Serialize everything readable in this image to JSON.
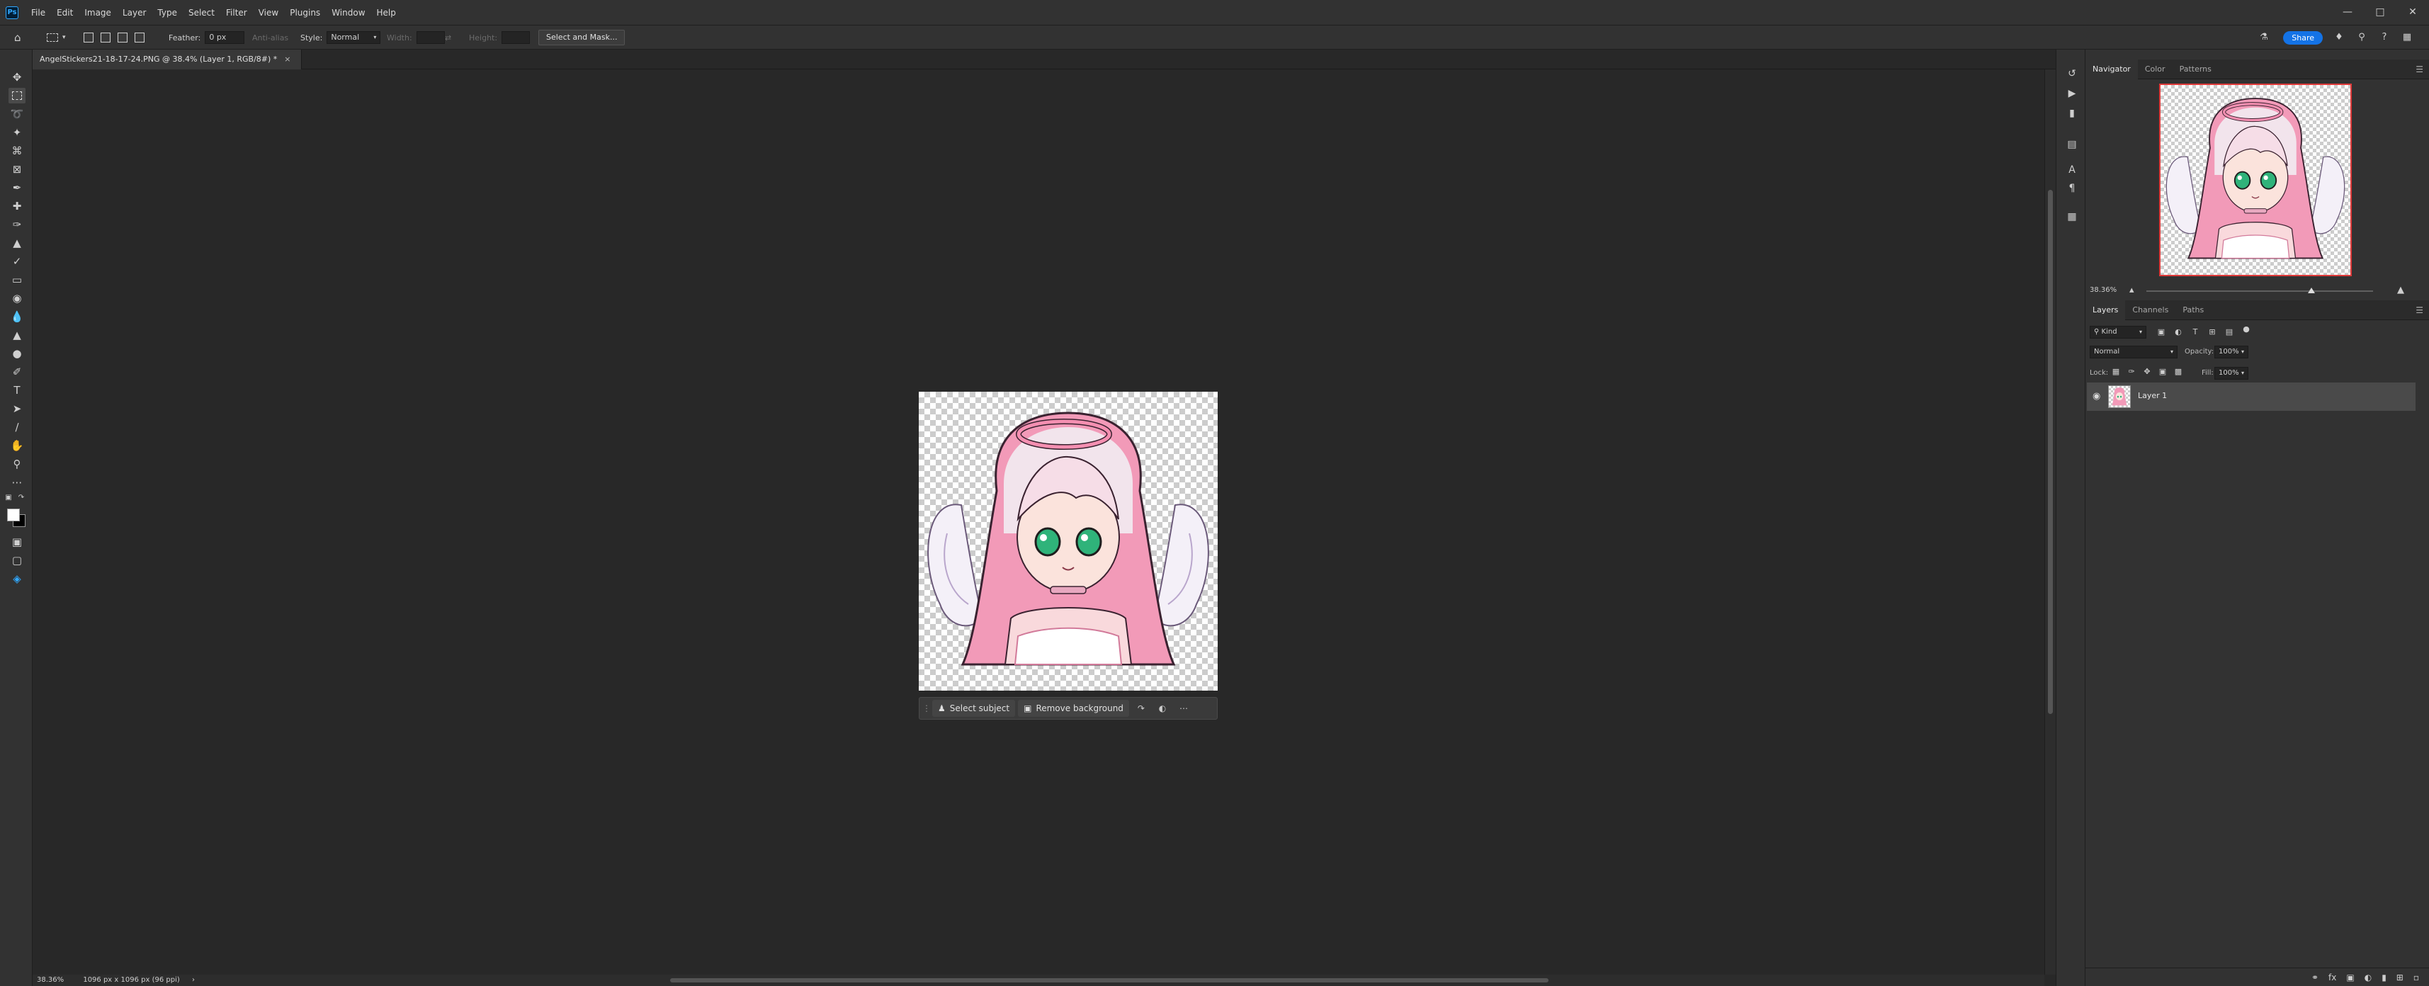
{
  "app": {
    "logo": "Ps"
  },
  "menu": [
    "File",
    "Edit",
    "Image",
    "Layer",
    "Type",
    "Select",
    "Filter",
    "View",
    "Plugins",
    "Window",
    "Help"
  ],
  "options": {
    "feather_label": "Feather:",
    "feather_value": "0 px",
    "antialias_label": "Anti-alias",
    "style_label": "Style:",
    "style_value": "Normal",
    "width_label": "Width:",
    "height_label": "Height:",
    "select_mask_label": "Select and Mask...",
    "share_label": "Share"
  },
  "document": {
    "tab_title": "AngelStickers21-18-17-24.PNG @ 38.4% (Layer 1, RGB/8#) *",
    "close_glyph": "×"
  },
  "context_bar": {
    "select_subject": "Select subject",
    "remove_background": "Remove background"
  },
  "status": {
    "zoom": "38.36%",
    "dimensions": "1096 px x 1096 px (96 ppi)"
  },
  "navigator": {
    "tabs": [
      "Navigator",
      "Color",
      "Patterns"
    ],
    "zoom": "38.36%"
  },
  "layers": {
    "tabs": [
      "Layers",
      "Channels",
      "Paths"
    ],
    "kind_label": "Kind",
    "blend_mode": "Normal",
    "opacity_label": "Opacity:",
    "opacity_value": "100%",
    "lock_label": "Lock:",
    "fill_label": "Fill:",
    "fill_value": "100%",
    "items": [
      {
        "name": "Layer 1",
        "visible": true
      }
    ]
  },
  "colors": {
    "accent": "#1473e6",
    "foreground": "#ffffff",
    "background": "#000000",
    "nav_frame": "#e03a3a"
  }
}
